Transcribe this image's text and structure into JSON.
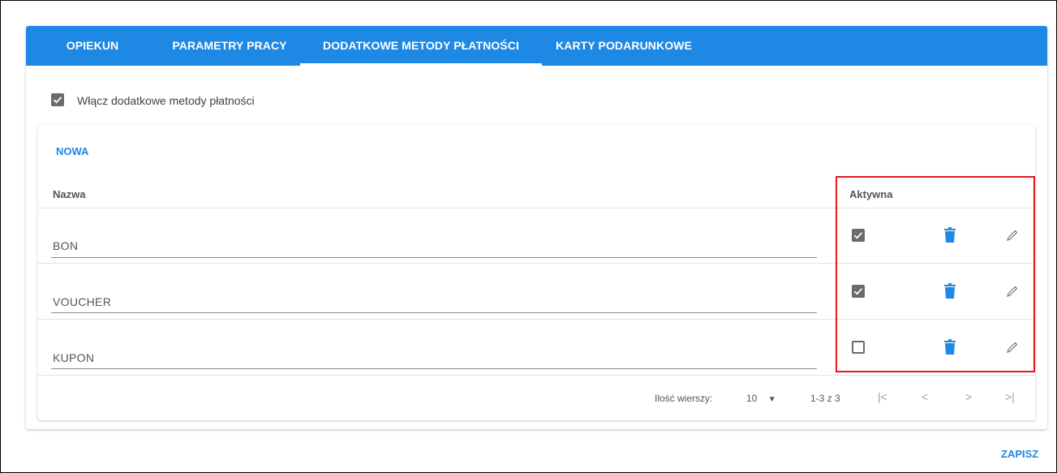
{
  "tabs": [
    {
      "label": "OPIEKUN"
    },
    {
      "label": "PARAMETRY PRACY"
    },
    {
      "label": "DODATKOWE METODY PŁATNOŚCI"
    },
    {
      "label": "KARTY PODARUNKOWE"
    }
  ],
  "active_tab": "DODATKOWE METODY PŁATNOŚCI",
  "enable_checkbox": {
    "label": "Włącz dodatkowe metody płatności",
    "checked": true
  },
  "new_button": {
    "label": "NOWA"
  },
  "table": {
    "columns": {
      "name": "Nazwa",
      "active": "Aktywna"
    },
    "rows": [
      {
        "name": "BON",
        "active": true
      },
      {
        "name": "VOUCHER",
        "active": true
      },
      {
        "name": "KUPON",
        "active": false
      }
    ]
  },
  "pagination": {
    "rows_per_page_label": "Ilość wierszy:",
    "rows_per_page_value": "10",
    "range": "1-3 z 3"
  },
  "save_button": {
    "label": "ZAPISZ"
  },
  "colors": {
    "accent": "#1e88e5",
    "highlight": "#e0191e",
    "checkbox": "#6b6b6b"
  }
}
